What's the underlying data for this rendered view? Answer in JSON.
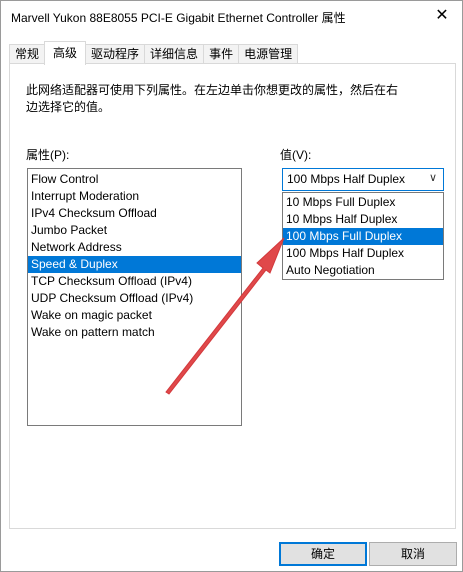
{
  "window": {
    "title": "Marvell Yukon 88E8055 PCI-E Gigabit Ethernet Controller 属性",
    "close_glyph": "✕"
  },
  "tabs": [
    {
      "label": "常规",
      "active": false
    },
    {
      "label": "高级",
      "active": true
    },
    {
      "label": "驱动程序",
      "active": false
    },
    {
      "label": "详细信息",
      "active": false
    },
    {
      "label": "事件",
      "active": false
    },
    {
      "label": "电源管理",
      "active": false
    }
  ],
  "advanced": {
    "description_line1": "此网络适配器可使用下列属性。在左边单击你想更改的属性，然后在右",
    "description_line2": "边选择它的值。",
    "properties_label": "属性(P):",
    "value_label": "值(V):",
    "properties": [
      {
        "label": "Flow Control",
        "selected": false
      },
      {
        "label": "Interrupt Moderation",
        "selected": false
      },
      {
        "label": "IPv4 Checksum Offload",
        "selected": false
      },
      {
        "label": "Jumbo Packet",
        "selected": false
      },
      {
        "label": "Network Address",
        "selected": false
      },
      {
        "label": "Speed & Duplex",
        "selected": true
      },
      {
        "label": "TCP Checksum Offload (IPv4)",
        "selected": false
      },
      {
        "label": "UDP Checksum Offload (IPv4)",
        "selected": false
      },
      {
        "label": "Wake on magic packet",
        "selected": false
      },
      {
        "label": "Wake on pattern match",
        "selected": false
      }
    ],
    "value_selected": "100 Mbps Half Duplex",
    "value_options": [
      {
        "label": "10 Mbps Full Duplex",
        "highlighted": false
      },
      {
        "label": "10 Mbps Half Duplex",
        "highlighted": false
      },
      {
        "label": "100 Mbps Full Duplex",
        "highlighted": true
      },
      {
        "label": "100 Mbps Half Duplex",
        "highlighted": false
      },
      {
        "label": "Auto Negotiation",
        "highlighted": false
      }
    ]
  },
  "buttons": {
    "ok": "确定",
    "cancel": "取消"
  },
  "colors": {
    "selection": "#0078d7",
    "annotation_arrow": "#e0484a"
  },
  "icons": {
    "chevron": "chevron-down-icon",
    "close": "close-icon"
  }
}
